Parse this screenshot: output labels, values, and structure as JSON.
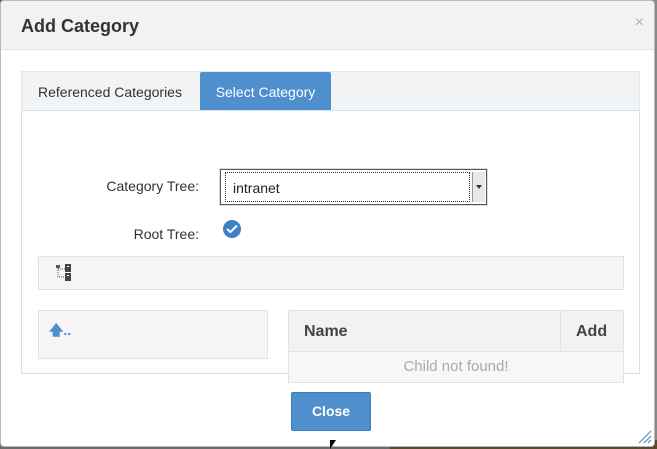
{
  "dialog": {
    "title": "Add Category",
    "close_symbol": "×"
  },
  "tabs": [
    {
      "label": "Referenced Categories",
      "active": false
    },
    {
      "label": "Select Category",
      "active": true
    }
  ],
  "form": {
    "category_tree_label": "Category Tree:",
    "category_tree_value": "intranet",
    "root_tree_label": "Root Tree:",
    "root_tree_checked": true
  },
  "navigator": {
    "up_label": ".."
  },
  "grid": {
    "columns": [
      "Name",
      "Add"
    ],
    "empty_message": "Child not found!"
  },
  "footer": {
    "close_label": "Close"
  },
  "colors": {
    "accent": "#4f8fcd",
    "titlebar": "#f2f2f2"
  },
  "icons": [
    "close-icon",
    "check-circle-icon",
    "tree-structure-icon",
    "arrow-up-icon",
    "resize-handle-icon"
  ]
}
